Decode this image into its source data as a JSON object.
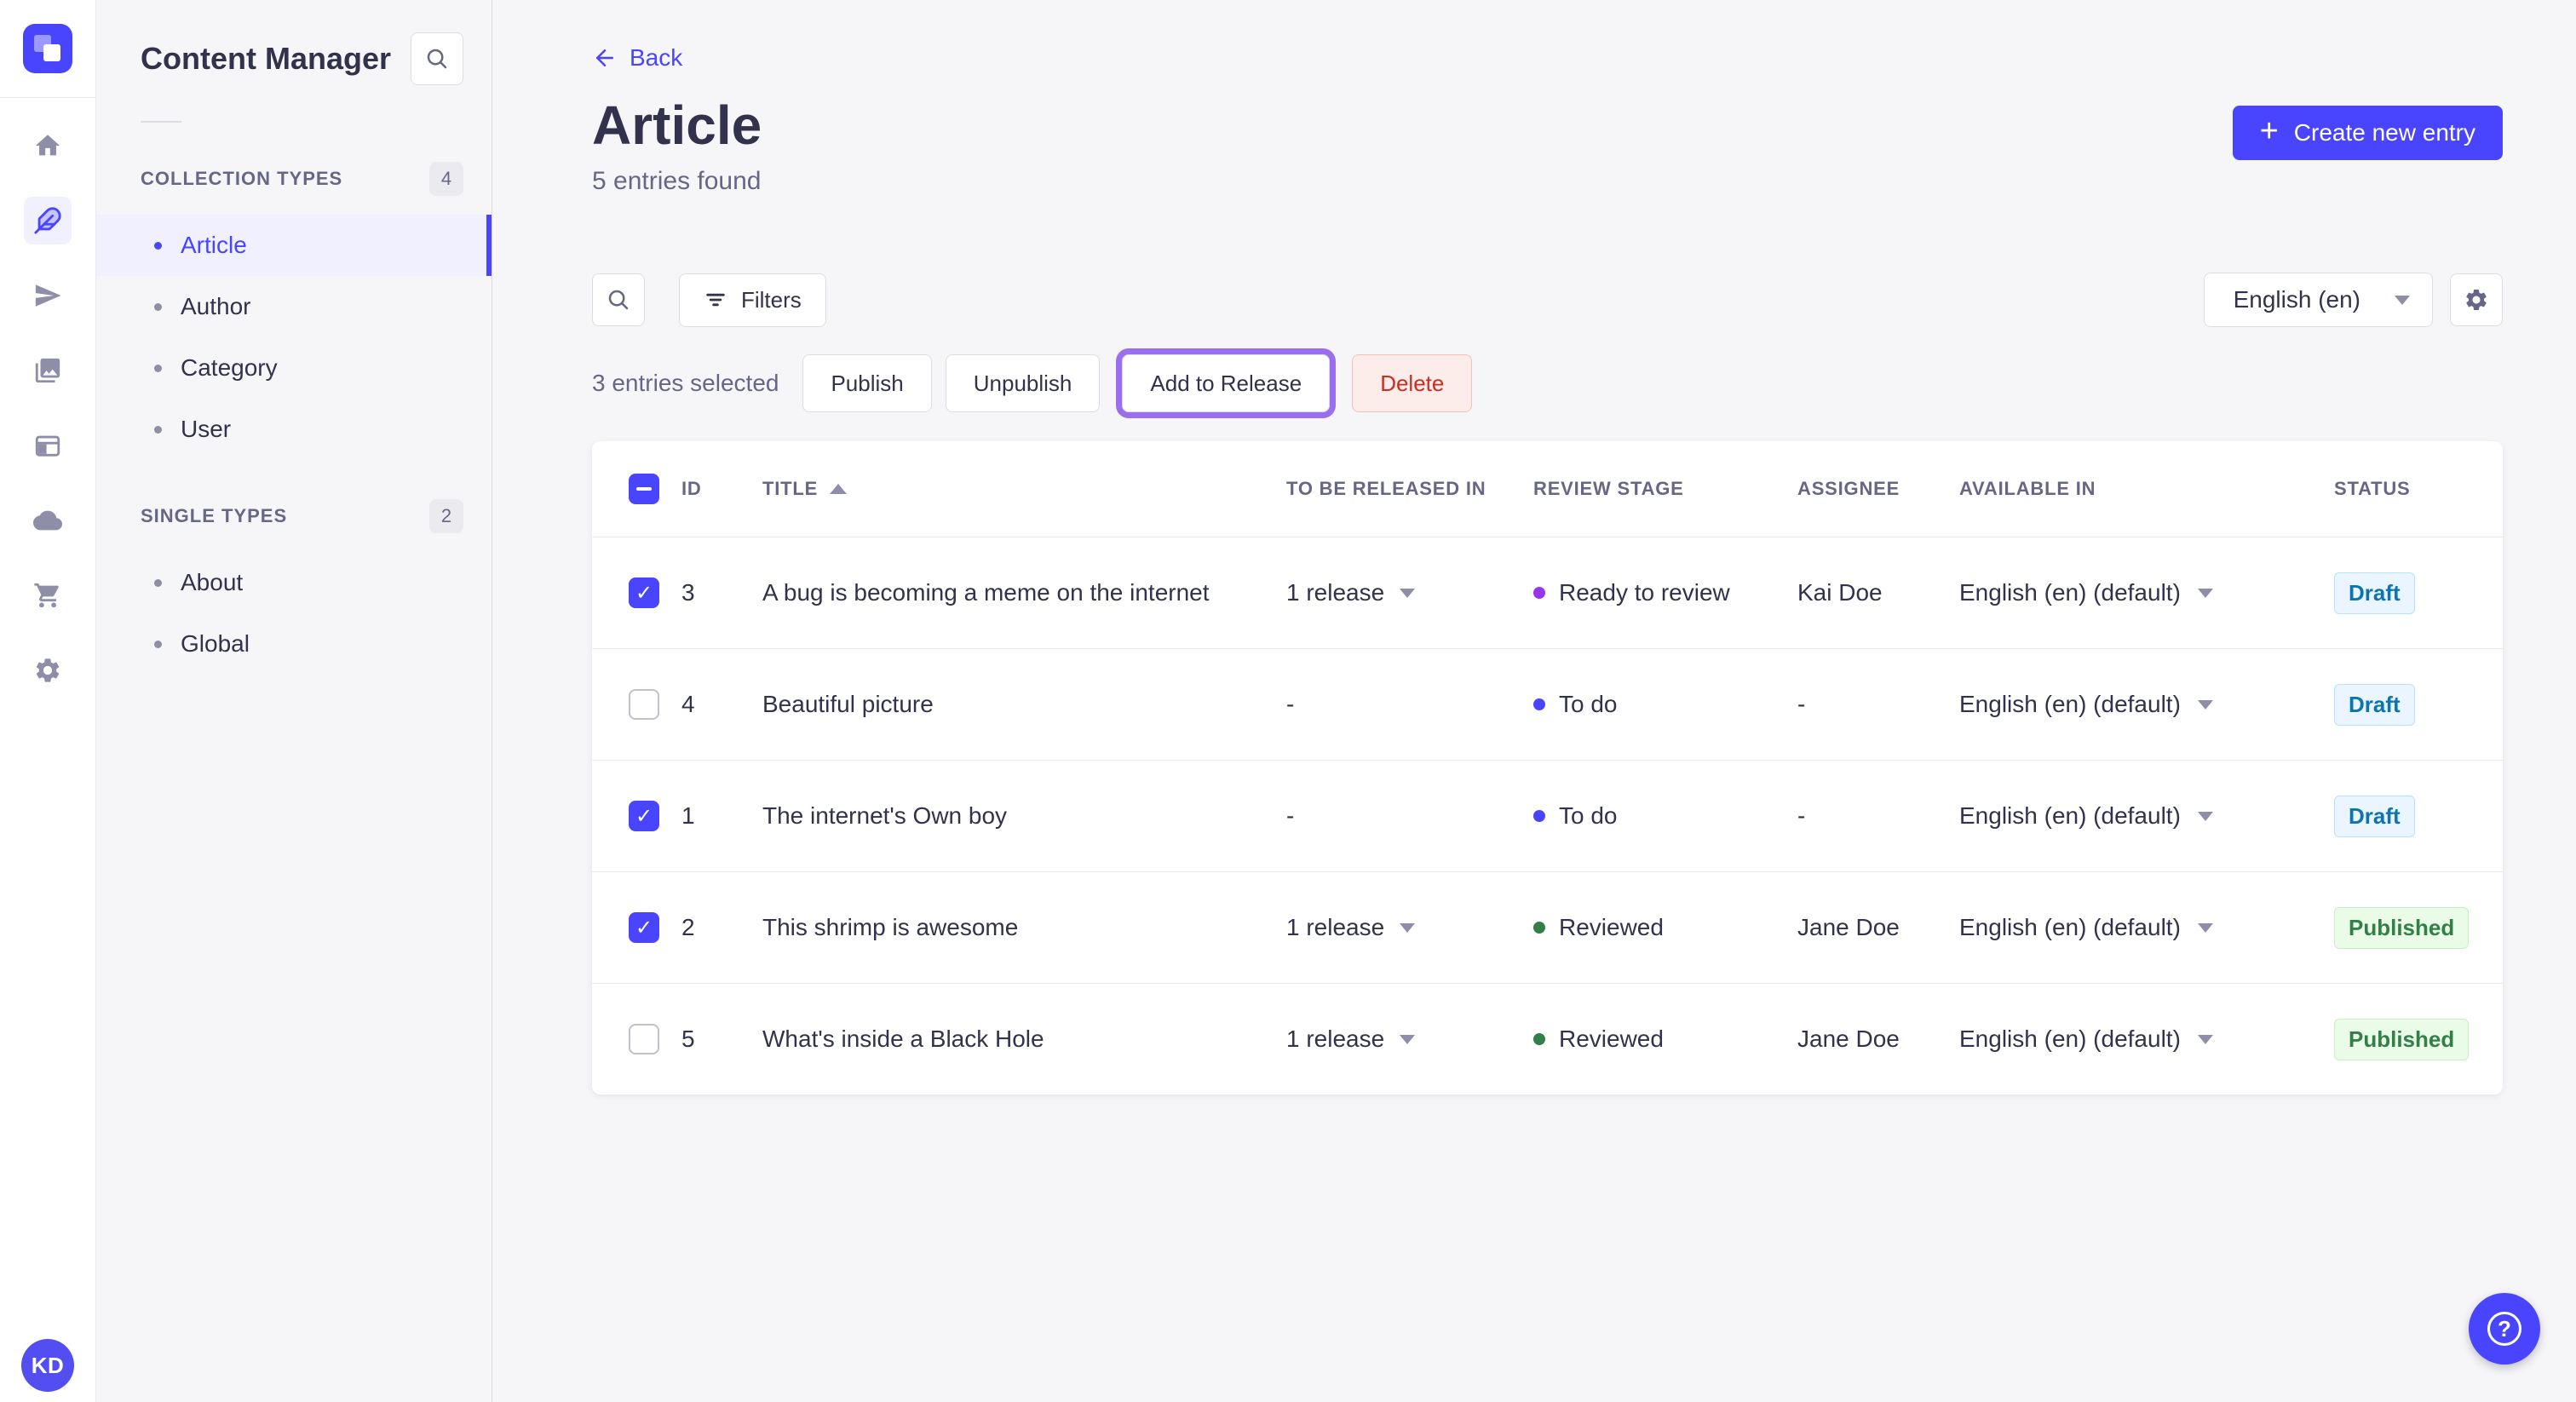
{
  "colors": {
    "primary": "#4945ff",
    "bg": "#f6f6f9",
    "focus_ring": "#9b6ef0",
    "draft_bg": "#eaf5ff",
    "draft_text": "#0c75af",
    "published_bg": "#eafbe7",
    "published_text": "#328048",
    "delete_bg": "#fcecea",
    "delete_text": "#d02b20"
  },
  "rail": {
    "avatar_initials": "KD"
  },
  "sidebar": {
    "title": "Content Manager",
    "sections": [
      {
        "label": "COLLECTION TYPES",
        "count": "4",
        "items": [
          {
            "label": "Article",
            "active": true
          },
          {
            "label": "Author"
          },
          {
            "label": "Category"
          },
          {
            "label": "User"
          }
        ]
      },
      {
        "label": "SINGLE TYPES",
        "count": "2",
        "items": [
          {
            "label": "About"
          },
          {
            "label": "Global"
          }
        ]
      }
    ]
  },
  "page": {
    "back_label": "Back",
    "title": "Article",
    "subtitle": "5 entries found",
    "create_button": "Create new entry"
  },
  "toolbar": {
    "filters_label": "Filters",
    "locale_value": "English (en)"
  },
  "selection": {
    "text": "3 entries selected",
    "publish": "Publish",
    "unpublish": "Unpublish",
    "add_to_release": "Add to Release",
    "delete": "Delete"
  },
  "table": {
    "headers": {
      "id": "ID",
      "title": "TITLE",
      "release": "TO BE RELEASED IN",
      "stage": "REVIEW STAGE",
      "assignee": "ASSIGNEE",
      "available": "AVAILABLE IN",
      "status": "STATUS"
    },
    "rows": [
      {
        "checked": true,
        "id": "3",
        "title": "A bug is becoming a meme on the internet",
        "release": "1 release",
        "stage": "Ready to review",
        "stage_color": "#9736e8",
        "assignee": "Kai Doe",
        "available": "English (en) (default)",
        "status": "Draft",
        "status_type": "draft"
      },
      {
        "checked": false,
        "id": "4",
        "title": "Beautiful picture",
        "release": "-",
        "stage": "To do",
        "stage_color": "#4945ff",
        "assignee": "-",
        "available": "English (en) (default)",
        "status": "Draft",
        "status_type": "draft"
      },
      {
        "checked": true,
        "id": "1",
        "title": "The internet's Own boy",
        "release": "-",
        "stage": "To do",
        "stage_color": "#4945ff",
        "assignee": "-",
        "available": "English (en) (default)",
        "status": "Draft",
        "status_type": "draft"
      },
      {
        "checked": true,
        "id": "2",
        "title": "This shrimp is awesome",
        "release": "1 release",
        "stage": "Reviewed",
        "stage_color": "#328048",
        "assignee": "Jane Doe",
        "available": "English (en) (default)",
        "status": "Published",
        "status_type": "published"
      },
      {
        "checked": false,
        "id": "5",
        "title": "What's inside a Black Hole",
        "release": "1 release",
        "stage": "Reviewed",
        "stage_color": "#328048",
        "assignee": "Jane Doe",
        "available": "English (en) (default)",
        "status": "Published",
        "status_type": "published"
      }
    ]
  },
  "fab": {
    "help": "?"
  }
}
